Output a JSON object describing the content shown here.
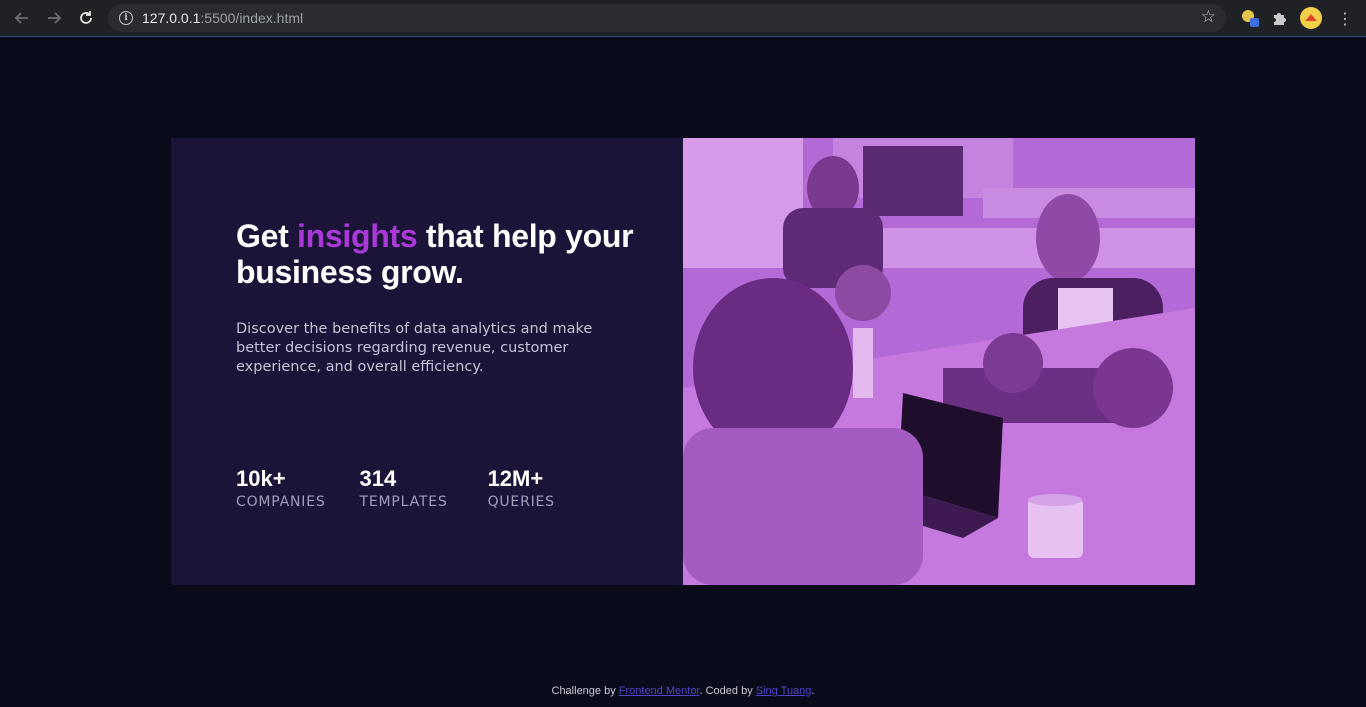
{
  "browser": {
    "url_host": "127.0.0.1",
    "url_path": ":5500/index.html"
  },
  "card": {
    "headline_pre": "Get ",
    "headline_accent": "insights",
    "headline_post": " that help your business grow.",
    "description": "Discover the benefits of data analytics and make better decisions regarding revenue, customer experience, and overall efficiency.",
    "stats": [
      {
        "value": "10k+",
        "label": "COMPANIES"
      },
      {
        "value": "314",
        "label": "TEMPLATES"
      },
      {
        "value": "12M+",
        "label": "QUERIES"
      }
    ],
    "image_tint": "#b46ad6"
  },
  "footer": {
    "prefix": "Challenge by ",
    "link1": "Frontend Mentor",
    "middle": ". Coded by ",
    "link2": "Sing Tuang",
    "suffix": "."
  },
  "colors": {
    "page_bg": "#090a1a",
    "card_bg": "#1c1438",
    "accent": "#a93ad8"
  }
}
